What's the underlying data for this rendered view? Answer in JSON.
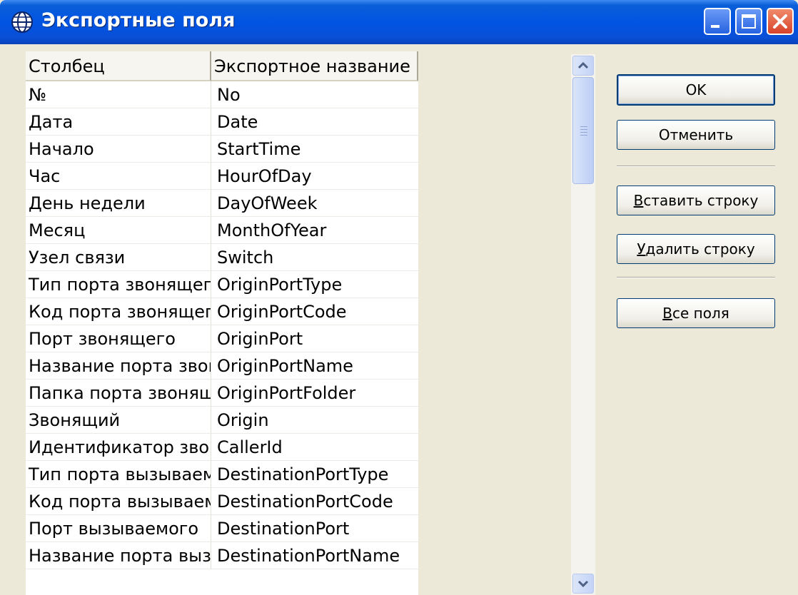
{
  "window": {
    "title": "Экспортные поля",
    "icon": "globe-icon",
    "controls": [
      "minimize-icon",
      "maximize-icon",
      "close-icon"
    ]
  },
  "table": {
    "columns": [
      "Столбец",
      "Экспортное название"
    ],
    "rows": [
      [
        "№",
        "No"
      ],
      [
        "Дата",
        "Date"
      ],
      [
        "Начало",
        "StartTime"
      ],
      [
        "Час",
        "HourOfDay"
      ],
      [
        "День недели",
        "DayOfWeek"
      ],
      [
        "Месяц",
        "MonthOfYear"
      ],
      [
        "Узел связи",
        "Switch"
      ],
      [
        "Тип порта звонящего",
        "OriginPortType"
      ],
      [
        "Код порта звонящего",
        "OriginPortCode"
      ],
      [
        "Порт звонящего",
        "OriginPort"
      ],
      [
        "Название порта звон...",
        "OriginPortName"
      ],
      [
        "Папка порта звонящ...",
        "OriginPortFolder"
      ],
      [
        "Звонящий",
        "Origin"
      ],
      [
        "Идентификатор звон...",
        "CallerId"
      ],
      [
        "Тип порта вызываем...",
        "DestinationPortType"
      ],
      [
        "Код порта вызываем...",
        "DestinationPortCode"
      ],
      [
        "Порт вызываемого",
        "DestinationPort"
      ],
      [
        "Название порта выз...",
        "DestinationPortName"
      ]
    ]
  },
  "buttons": {
    "ok": "OK",
    "cancel": "Отменить",
    "insert_row": {
      "mnemonic": "В",
      "rest": "ставить строку"
    },
    "delete_row": {
      "mnemonic": "У",
      "rest": "далить строку"
    },
    "all_fields": {
      "mnemonic": "В",
      "rest": "се поля"
    }
  },
  "colors": {
    "titlebar": "#0054e3",
    "window_bg": "#ece9d8",
    "close_button": "#d8432a"
  }
}
